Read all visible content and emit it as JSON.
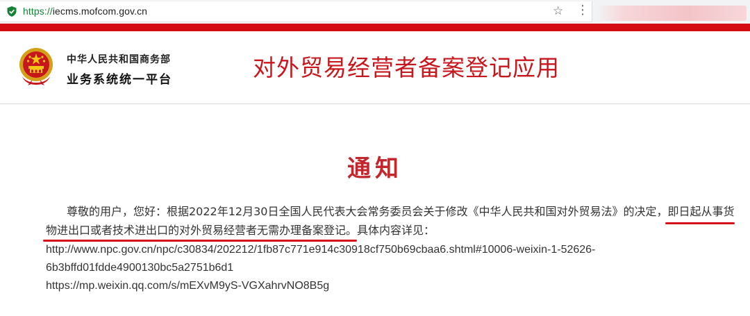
{
  "browser": {
    "url_scheme": "https://",
    "url_host": "iecms.mofcom.gov.cn"
  },
  "header": {
    "org_name": "中华人民共和国商务部",
    "platform_name": "业务系统统一平台",
    "app_title": "对外贸易经营者备案登记应用"
  },
  "notice": {
    "title": "通知",
    "para1_line1_prefix": "尊敬的用户，您好：根据2022年12月30日全国人民代表大会常务委员会关于修改《中华人民共和国对外贸易法》的决定，",
    "para1_line1_highlight": "即日起从事货",
    "para1_line2_highlight": "物进出口或者技术进出口的对外贸易经营者无需办理备案登记。",
    "para1_line2_suffix": "具体内容详见：",
    "link1_line1": "http://www.npc.gov.cn/npc/c30834/202212/1fb87c771e914c30918cf750b69cbaa6.shtml#10006-weixin-1-52626-",
    "link1_line2": "6b3bffd01fdde4900130bc5a2751b6d1",
    "link2": "https://mp.weixin.qq.com/s/mEXvM9yS-VGXahrvNO8B5g"
  },
  "colors": {
    "brand_red": "#d40d12",
    "title_red": "#c1272d",
    "secure_green": "#188038"
  },
  "icons": {
    "secure": "shield-check-icon",
    "bookmark": "star-icon",
    "menu": "more-vert-icon",
    "emblem": "national-emblem-icon"
  }
}
